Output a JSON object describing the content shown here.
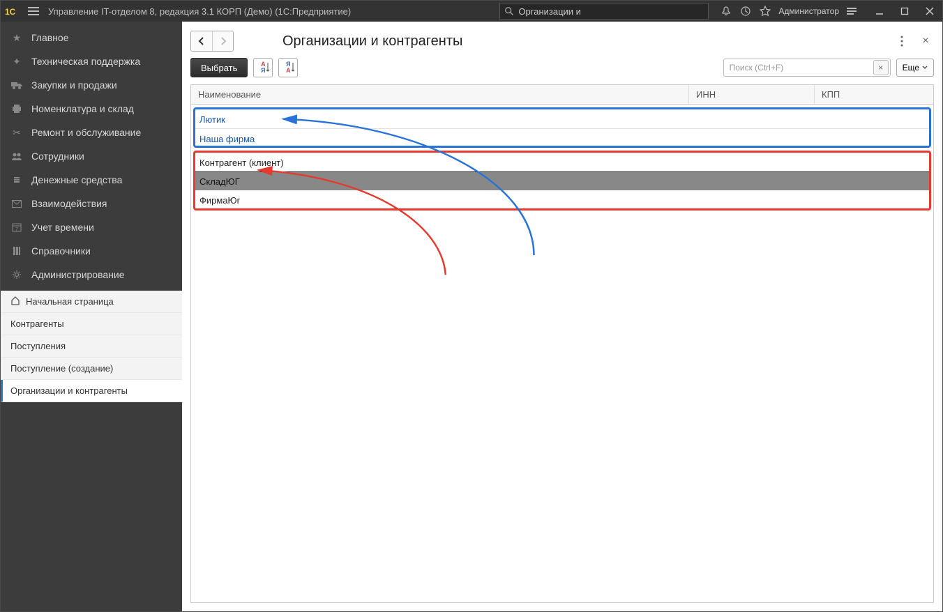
{
  "titlebar": {
    "app_title": "Управление IT-отделом 8, редакция 3.1 КОРП (Демо)  (1С:Предприятие)",
    "search_text": "Организации и",
    "user": "Администратор"
  },
  "sidebar": {
    "nav": [
      {
        "label": "Главное",
        "icon": "star"
      },
      {
        "label": "Техническая поддержка",
        "icon": "lifebuoy"
      },
      {
        "label": "Закупки и продажи",
        "icon": "truck"
      },
      {
        "label": "Номенклатура и склад",
        "icon": "printer"
      },
      {
        "label": "Ремонт и обслуживание",
        "icon": "tools"
      },
      {
        "label": "Сотрудники",
        "icon": "users"
      },
      {
        "label": "Денежные средства",
        "icon": "money"
      },
      {
        "label": "Взаимодействия",
        "icon": "mail"
      },
      {
        "label": "Учет времени",
        "icon": "calendar"
      },
      {
        "label": "Справочники",
        "icon": "books"
      },
      {
        "label": "Администрирование",
        "icon": "gear"
      }
    ],
    "sub": [
      {
        "label": "Начальная страница",
        "home": true
      },
      {
        "label": "Контрагенты"
      },
      {
        "label": "Поступления"
      },
      {
        "label": "Поступление (создание)"
      },
      {
        "label": "Организации и контрагенты",
        "active": true
      }
    ]
  },
  "page": {
    "title": "Организации и контрагенты",
    "select_btn": "Выбрать",
    "search_placeholder": "Поиск (Ctrl+F)",
    "more_btn": "Еще"
  },
  "table": {
    "columns": {
      "name": "Наименование",
      "inn": "ИНН",
      "kpp": "КПП"
    },
    "group_orgs": [
      {
        "name": "Лютик"
      },
      {
        "name": "Наша фирма"
      }
    ],
    "group_contragents_header": "Контрагент (клиент)",
    "group_contragents": [
      {
        "name": "СкладЮГ",
        "selected": true
      },
      {
        "name": "ФирмаЮг"
      }
    ]
  }
}
